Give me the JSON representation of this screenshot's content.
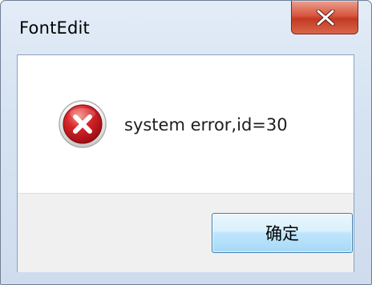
{
  "window": {
    "title": "FontEdit",
    "close_label": "X"
  },
  "dialog": {
    "icon": "error-icon",
    "message": "system error,id=30",
    "ok_label": "确定"
  },
  "colors": {
    "close_button": "#c7432b",
    "error_icon": "#c4161c",
    "button_border": "#3c7fb1"
  }
}
